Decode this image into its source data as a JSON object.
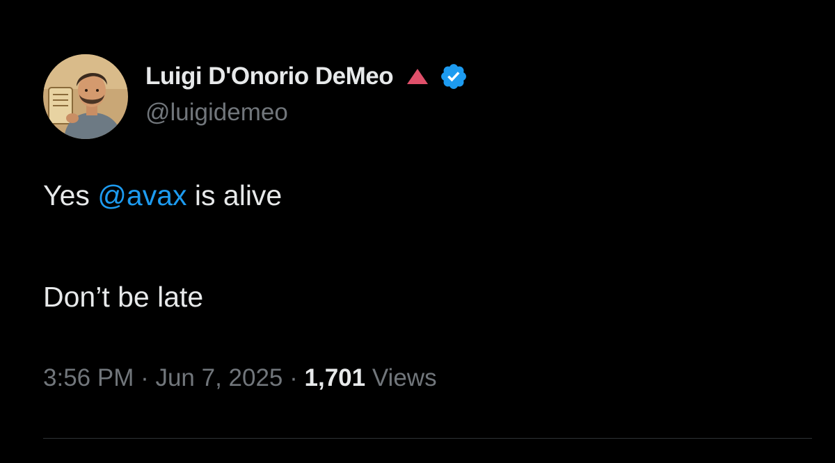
{
  "author": {
    "display_name": "Luigi D'Onorio DeMeo",
    "handle": "@luigidemeo",
    "avatar_icon": "avatar-portrait",
    "badge_icons": [
      "red-triangle-icon",
      "verified-badge-icon"
    ]
  },
  "tweet": {
    "line1_prefix": "Yes ",
    "mention": "@avax",
    "line1_suffix": " is alive",
    "line2": "Don’t be late"
  },
  "meta": {
    "time": "3:56 PM",
    "separator": " · ",
    "date": "Jun 7, 2025",
    "separator2": " · ",
    "views_count": "1,701",
    "views_label": " Views"
  },
  "colors": {
    "background": "#000000",
    "text": "#e7e9ea",
    "secondary": "#71767b",
    "link": "#1d9bf0",
    "triangle": "#e0506a",
    "verified": "#1d9bf0",
    "divider": "#2f3336"
  }
}
